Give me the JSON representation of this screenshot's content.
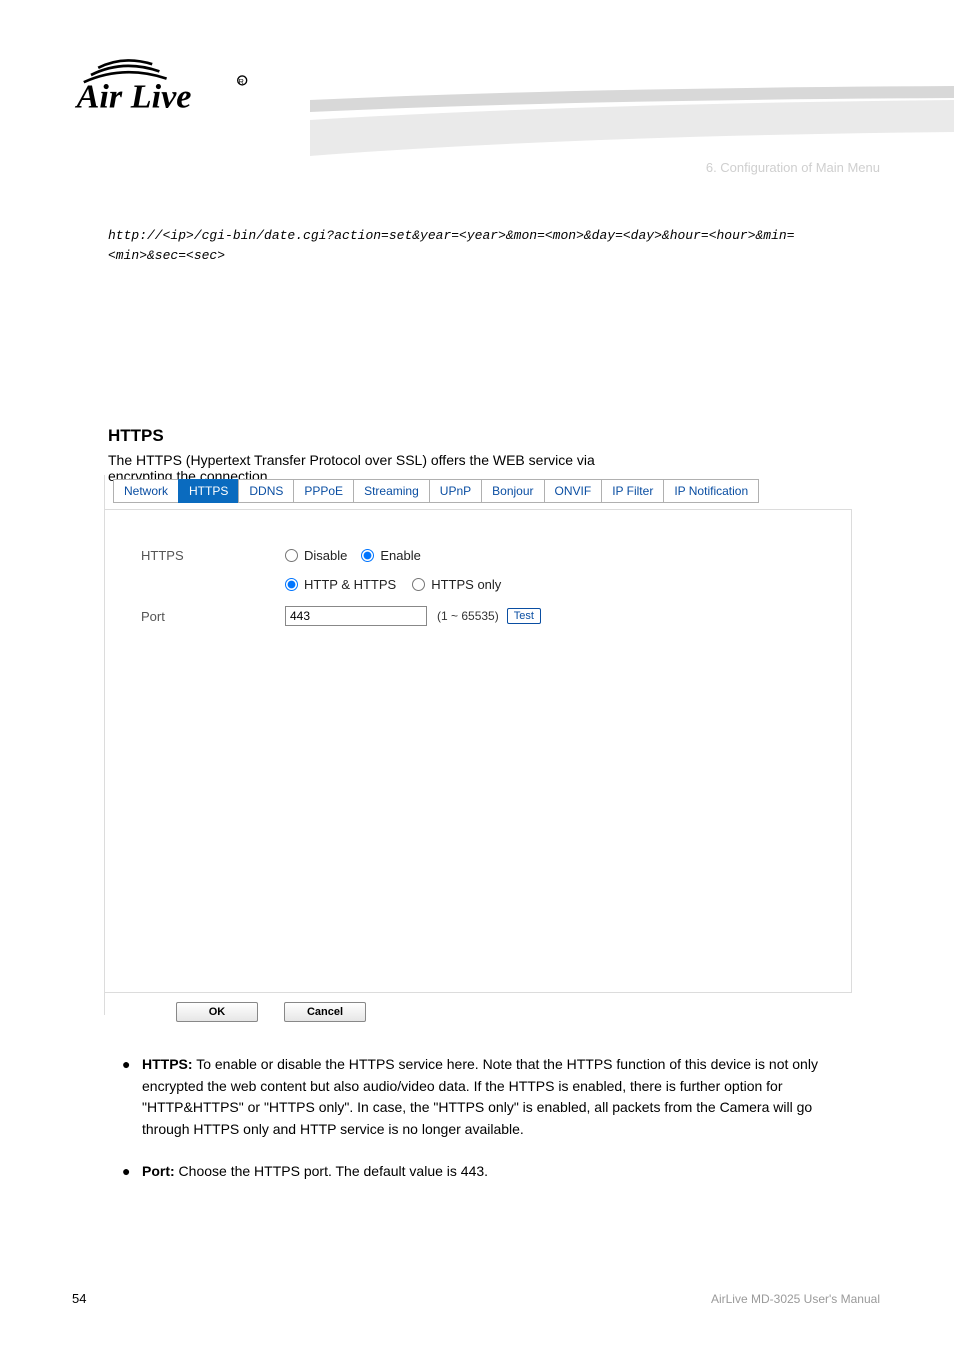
{
  "chapter_label": "6. Configuration of Main Menu",
  "code_text": "http://<ip>/cgi-bin/date.cgi?action=set&year=<year>&mon=<mon>&day=<day>&hour=<hour>&min=<min>&sec=<sec>",
  "section": {
    "heading": "HTTPS",
    "desc_line1": "The HTTPS (Hypertext Transfer Protocol over SSL) offers the WEB service via",
    "desc_line2": "encrypting the connection."
  },
  "tabs": [
    {
      "id": "network",
      "label": "Network"
    },
    {
      "id": "https",
      "label": "HTTPS",
      "active": true
    },
    {
      "id": "ddns",
      "label": "DDNS"
    },
    {
      "id": "pppoe",
      "label": "PPPoE"
    },
    {
      "id": "streaming",
      "label": "Streaming"
    },
    {
      "id": "upnp",
      "label": "UPnP"
    },
    {
      "id": "bonjour",
      "label": "Bonjour"
    },
    {
      "id": "onvif",
      "label": "ONVIF"
    },
    {
      "id": "ipfilter",
      "label": "IP Filter"
    },
    {
      "id": "ipnotif",
      "label": "IP Notification"
    }
  ],
  "form": {
    "https_label": "HTTPS",
    "disable": "Disable",
    "enable": "Enable",
    "mode_both": "HTTP & HTTPS",
    "mode_only": "HTTPS only",
    "port_label": "Port",
    "port_value": "443",
    "port_hint": "(1 ~ 65535)",
    "test": "Test"
  },
  "buttons": {
    "ok": "OK",
    "cancel": "Cancel"
  },
  "bullets": [
    {
      "ttl": "HTTPS:",
      "body": " To enable or disable the HTTPS service here. Note that the HTTPS function of this device is not only encrypted the web content but also audio/video data. If the HTTPS is enabled, there is further option for \"HTTP&HTTPS\" or \"HTTPS only\". In case, the \"HTTPS only\" is enabled, all packets from the Camera will go through HTTPS only and HTTP service is no longer available."
    },
    {
      "ttl": "Port:",
      "body": " Choose the HTTPS port. The default value is 443."
    }
  ],
  "footer_left": "54",
  "footer_right": "AirLive MD-3025 User's Manual"
}
